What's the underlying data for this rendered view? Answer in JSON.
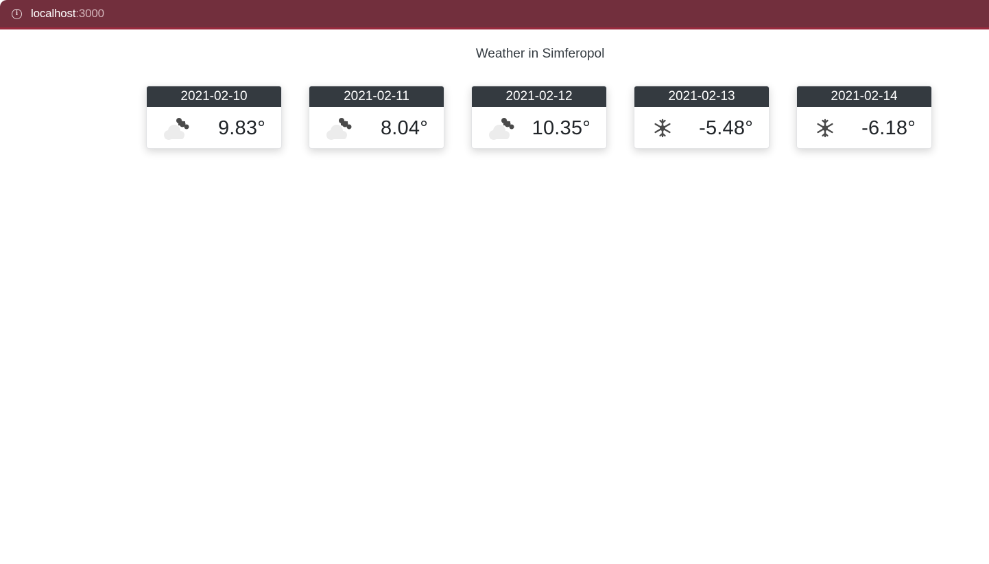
{
  "browser": {
    "url_host": "localhost",
    "url_port": ":3000",
    "accent_color": "#722f3d"
  },
  "page": {
    "title": "Weather in Simferopol"
  },
  "forecast": [
    {
      "date": "2021-02-10",
      "icon": "cloud-icon",
      "temp": "9.83°"
    },
    {
      "date": "2021-02-11",
      "icon": "cloud-icon",
      "temp": "8.04°"
    },
    {
      "date": "2021-02-12",
      "icon": "cloud-icon",
      "temp": "10.35°"
    },
    {
      "date": "2021-02-13",
      "icon": "snowflake-icon",
      "temp": "-5.48°"
    },
    {
      "date": "2021-02-14",
      "icon": "snowflake-icon",
      "temp": "-6.18°"
    }
  ]
}
